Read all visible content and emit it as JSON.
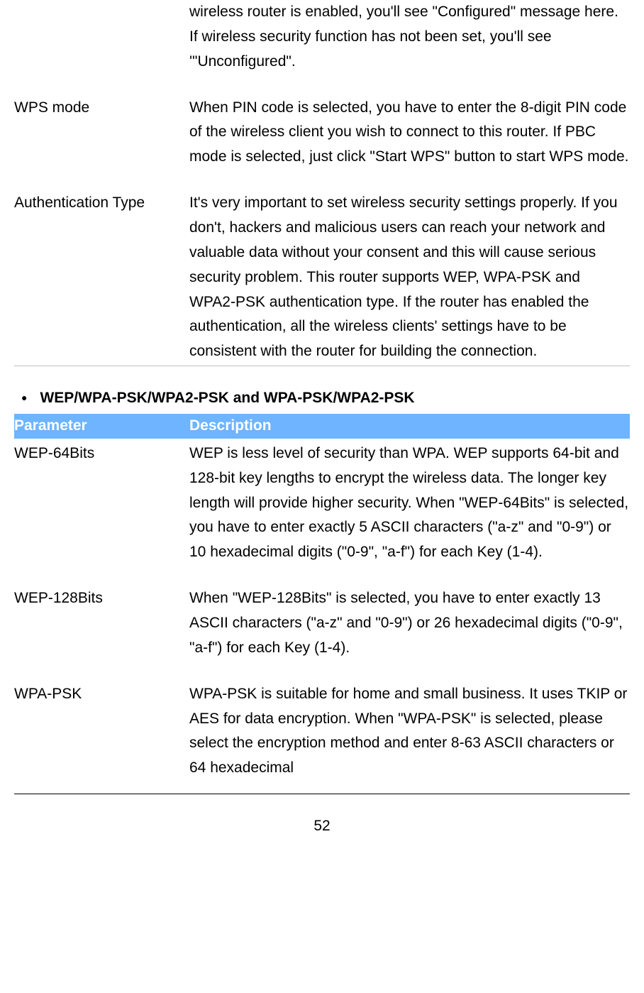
{
  "section1": {
    "rows": [
      {
        "label": "",
        "desc": "wireless router is enabled, you'll see \"Configured\" message here. If wireless security function has not been set, you'll see '\"Unconfigured\"."
      },
      {
        "label": "WPS mode",
        "desc": "When PIN code is selected, you have to enter the 8-digit PIN code of the wireless client you wish to connect to this router.  If PBC mode is selected, just click \"Start WPS\" button to start WPS mode."
      },
      {
        "label": "Authentication Type",
        "desc": "It's very important to set wireless security settings properly. If you don't, hackers and malicious users can reach your network and valuable data without your consent and this will cause serious security problem. This router supports WEP, WPA-PSK and WPA2-PSK authentication type. If the router has enabled the authentication, all the wireless clients' settings have to be consistent with the router for building the connection."
      }
    ]
  },
  "heading2": "WEP/WPA-PSK/WPA2-PSK and WPA-PSK/WPA2-PSK",
  "tableHeader": {
    "param": "Parameter",
    "desc": "Description"
  },
  "section2": {
    "rows": [
      {
        "label": "WEP-64Bits",
        "desc": "WEP is less level of security than WPA. WEP supports 64-bit and 128-bit key lengths to encrypt the wireless data. The longer key length will provide higher security. When \"WEP-64Bits\" is selected, you have to enter exactly 5 ASCII characters (\"a-z\" and \"0-9\") or 10 hexadecimal digits (\"0-9\", \"a-f\") for each Key (1-4)."
      },
      {
        "label": "WEP-128Bits",
        "desc": "When \"WEP-128Bits\" is selected, you have to enter exactly 13 ASCII characters (\"a-z\" and \"0-9\") or 26 hexadecimal digits (\"0-9\", \"a-f\") for each Key (1-4)."
      },
      {
        "label": "WPA-PSK",
        "desc": "WPA-PSK is suitable for home and small business. It uses TKIP or AES for data encryption. When \"WPA-PSK\" is selected, please select the encryption method and enter 8-63 ASCII characters or 64 hexadecimal"
      }
    ]
  },
  "pageNumber": "52"
}
